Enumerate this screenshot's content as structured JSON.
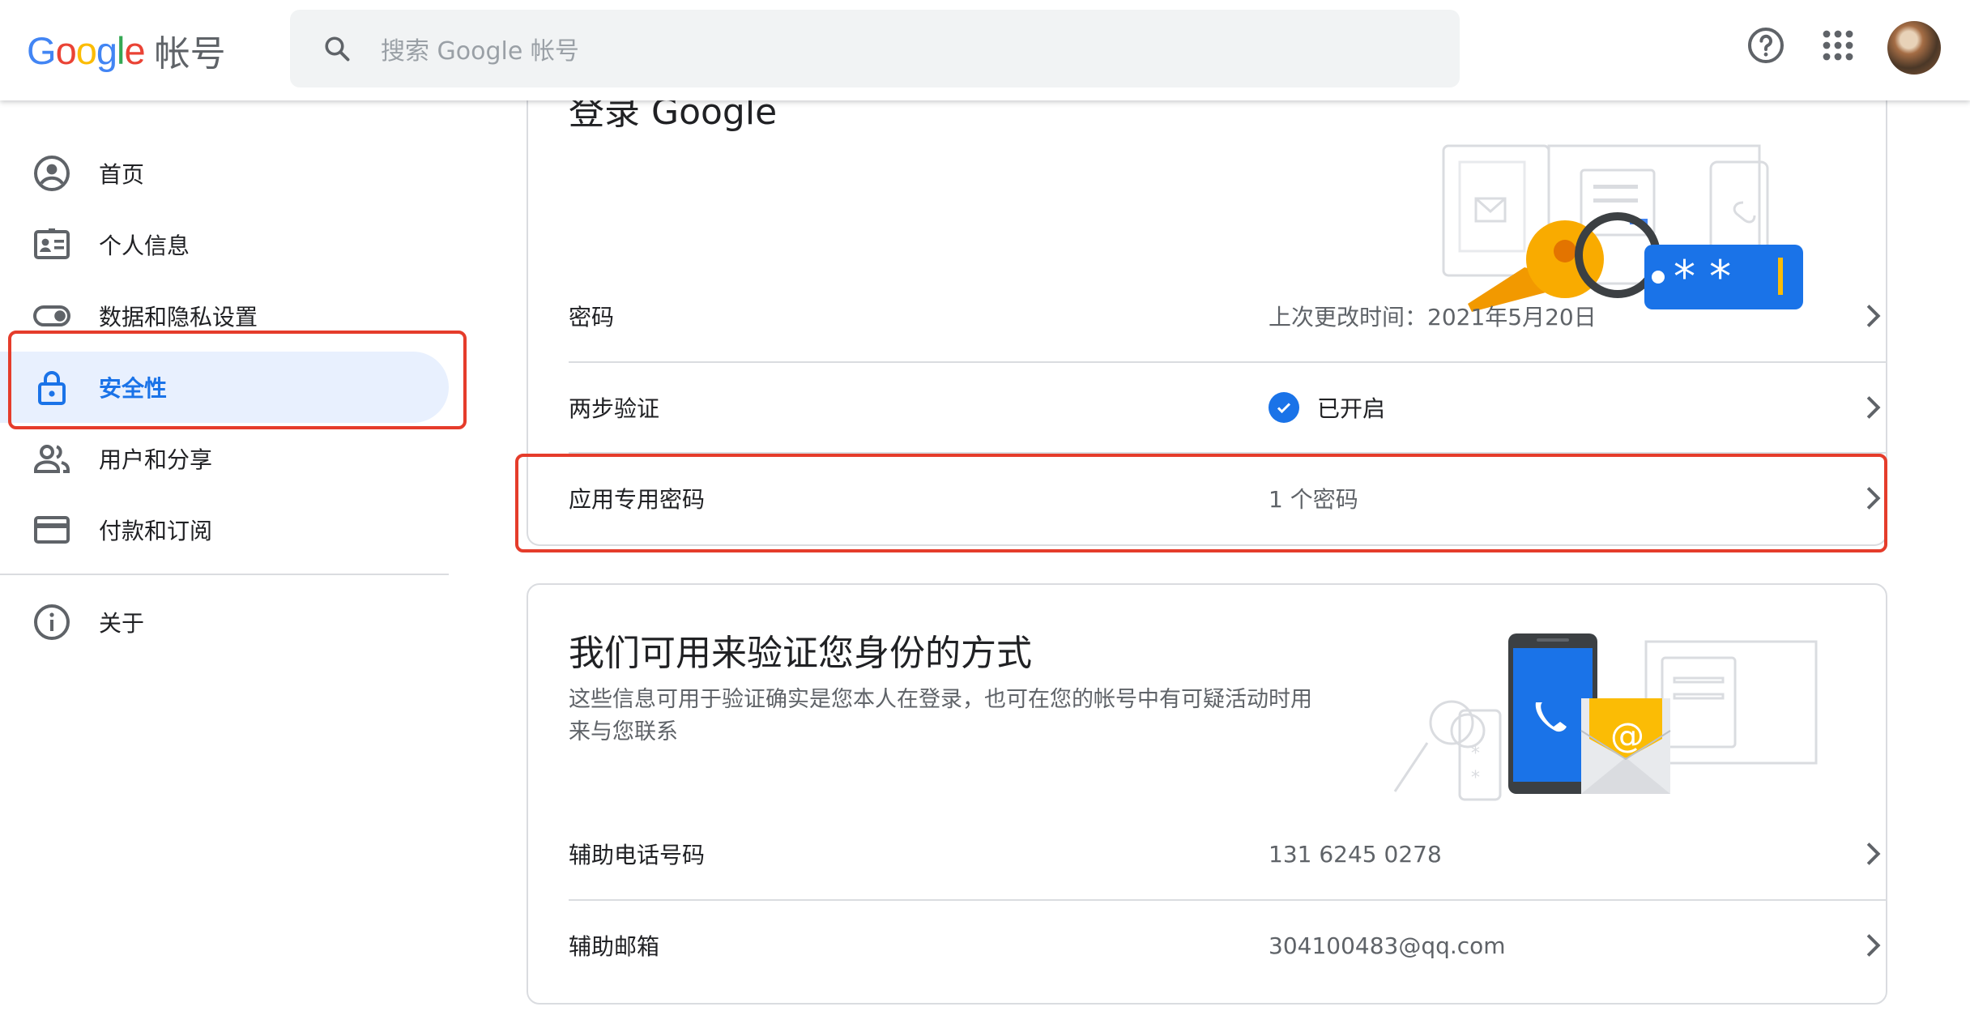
{
  "header": {
    "logo_text": "Google",
    "product_name": "帐号",
    "search_placeholder": "搜索 Google 帐号",
    "help_icon": "help-circle-icon",
    "apps_icon": "apps-grid-icon"
  },
  "sidebar": {
    "items": [
      {
        "label": "首页",
        "icon": "account-circle-icon"
      },
      {
        "label": "个人信息",
        "icon": "id-card-icon"
      },
      {
        "label": "数据和隐私设置",
        "icon": "toggle-icon"
      },
      {
        "label": "安全性",
        "icon": "lock-icon",
        "active": true
      },
      {
        "label": "用户和分享",
        "icon": "people-icon"
      },
      {
        "label": "付款和订阅",
        "icon": "credit-card-icon"
      }
    ],
    "about": {
      "label": "关于",
      "icon": "info-icon"
    }
  },
  "signin_card": {
    "title": "登录 Google",
    "rows": [
      {
        "label": "密码",
        "value": "上次更改时间：2021年5月20日"
      },
      {
        "label": "两步验证",
        "value": "已开启"
      },
      {
        "label": "应用专用密码",
        "value": "1 个密码"
      }
    ]
  },
  "verify_card": {
    "title": "我们可用来验证您身份的方式",
    "description": "这些信息可用于验证确实是您本人在登录，也可在您的帐号中有可疑活动时用来与您联系",
    "rows": [
      {
        "label": "辅助电话号码",
        "value": "131 6245 0278"
      },
      {
        "label": "辅助邮箱",
        "value": "304100483@qq.com"
      }
    ]
  },
  "colors": {
    "accent": "#1a73e8",
    "active_bg": "#e8f0fe",
    "highlight_red": "#e53c2b"
  }
}
